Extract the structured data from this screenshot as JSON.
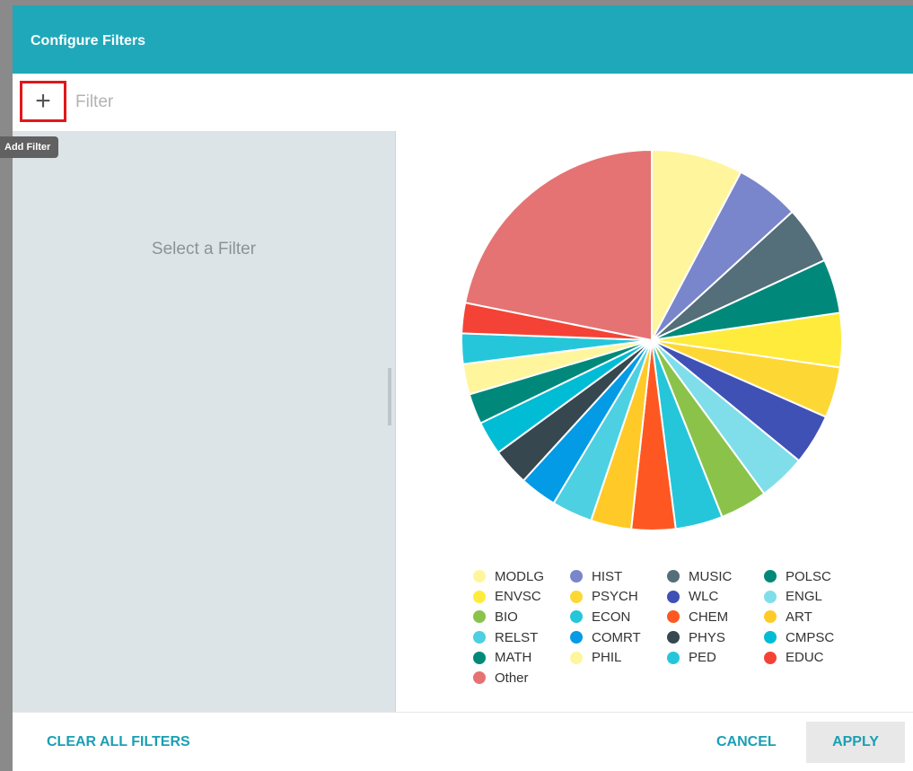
{
  "dialog": {
    "title": "Configure Filters"
  },
  "filter_bar": {
    "add_button_symbol": "+",
    "add_button_icon": "plus-icon",
    "add_tooltip": "Add Filter",
    "placeholder": "Filter"
  },
  "left_panel": {
    "empty_message": "Select a Filter"
  },
  "chart_data": {
    "type": "pie",
    "title": "",
    "slices": [
      {
        "label": "MODLG",
        "value": 27,
        "color": "#fff59d"
      },
      {
        "label": "HIST",
        "value": 19,
        "color": "#7986cb"
      },
      {
        "label": "MUSIC",
        "value": 17,
        "color": "#546e7a"
      },
      {
        "label": "POLSC",
        "value": 16,
        "color": "#00897b"
      },
      {
        "label": "ENVSC",
        "value": 16,
        "color": "#ffeb3b"
      },
      {
        "label": "PSYCH",
        "value": 15,
        "color": "#fdd835"
      },
      {
        "label": "WLC",
        "value": 15,
        "color": "#3f51b5"
      },
      {
        "label": "ENGL",
        "value": 14,
        "color": "#80deea"
      },
      {
        "label": "BIO",
        "value": 14,
        "color": "#8bc34a"
      },
      {
        "label": "ECON",
        "value": 14,
        "color": "#26c6da"
      },
      {
        "label": "CHEM",
        "value": 13,
        "color": "#ff5722"
      },
      {
        "label": "ART",
        "value": 12,
        "color": "#ffca28"
      },
      {
        "label": "RELST",
        "value": 12,
        "color": "#4dd0e1"
      },
      {
        "label": "COMRT",
        "value": 11,
        "color": "#039be5"
      },
      {
        "label": "PHYS",
        "value": 11,
        "color": "#37474f"
      },
      {
        "label": "CMPSC",
        "value": 10,
        "color": "#00bcd4"
      },
      {
        "label": "MATH",
        "value": 9,
        "color": "#00897b"
      },
      {
        "label": "PHIL",
        "value": 9,
        "color": "#fff59d"
      },
      {
        "label": "PED",
        "value": 9,
        "color": "#26c6da"
      },
      {
        "label": "EDUC",
        "value": 9,
        "color": "#f44336"
      },
      {
        "label": "Other",
        "value": 76,
        "color": "#e57373"
      }
    ],
    "legend_position": "bottom"
  },
  "footer": {
    "clear_all": "CLEAR ALL FILTERS",
    "cancel": "CANCEL",
    "apply": "APPLY"
  }
}
